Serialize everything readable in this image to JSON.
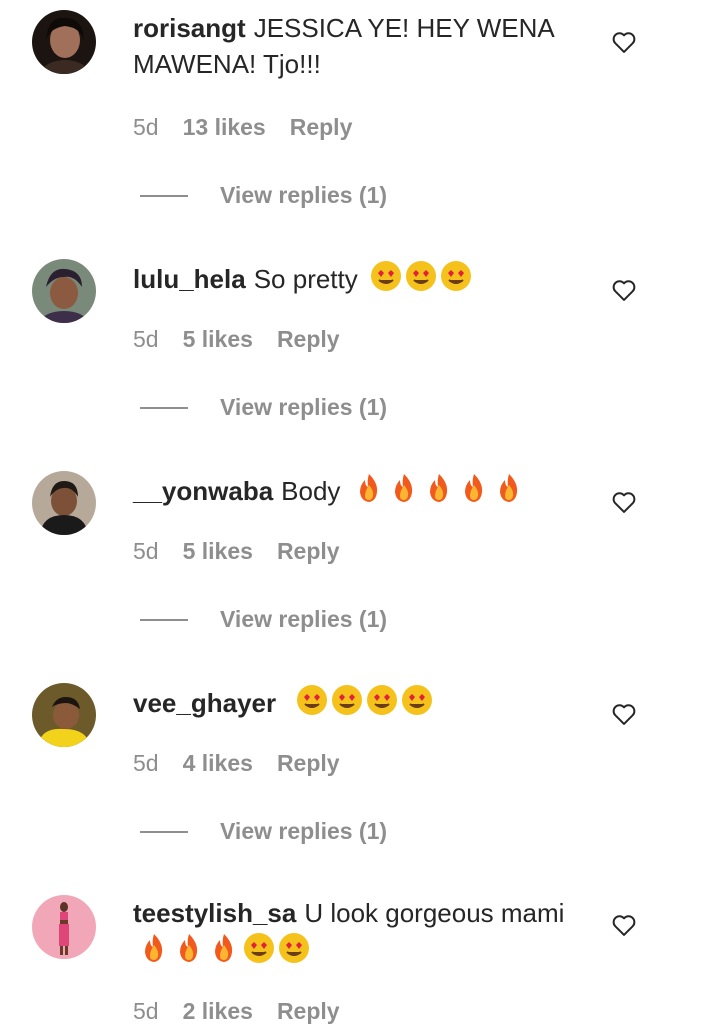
{
  "comments": [
    {
      "username": "rorisangt",
      "text": "JESSICA YE! HEY WENA MAWENA! Tjo!!!",
      "emojis": [],
      "time": "5d",
      "likes": "13 likes",
      "reply": "Reply",
      "view_replies": "View replies (1)"
    },
    {
      "username": "lulu_hela",
      "text": "So pretty",
      "emojis": [
        "heart-eyes-emoji",
        "heart-eyes-emoji",
        "heart-eyes-emoji"
      ],
      "time": "5d",
      "likes": "5 likes",
      "reply": "Reply",
      "view_replies": "View replies (1)"
    },
    {
      "username": "__yonwaba",
      "text": "Body",
      "emojis": [
        "fire-emoji",
        "fire-emoji",
        "fire-emoji",
        "fire-emoji",
        "fire-emoji"
      ],
      "time": "5d",
      "likes": "5 likes",
      "reply": "Reply",
      "view_replies": "View replies (1)"
    },
    {
      "username": "vee_ghayer",
      "text": "",
      "emojis": [
        "heart-eyes-emoji",
        "heart-eyes-emoji",
        "heart-eyes-emoji",
        "heart-eyes-emoji"
      ],
      "time": "5d",
      "likes": "4 likes",
      "reply": "Reply",
      "view_replies": "View replies (1)"
    },
    {
      "username": "teestylish_sa",
      "text": "U look gorgeous mami",
      "emojis": [
        "fire-emoji",
        "fire-emoji",
        "fire-emoji",
        "heart-eyes-emoji",
        "heart-eyes-emoji"
      ],
      "time": "5d",
      "likes": "2 likes",
      "reply": "Reply",
      "view_replies": ""
    }
  ],
  "colors": {
    "text": "#262626",
    "muted": "#8e8e8e",
    "background": "#ffffff"
  }
}
